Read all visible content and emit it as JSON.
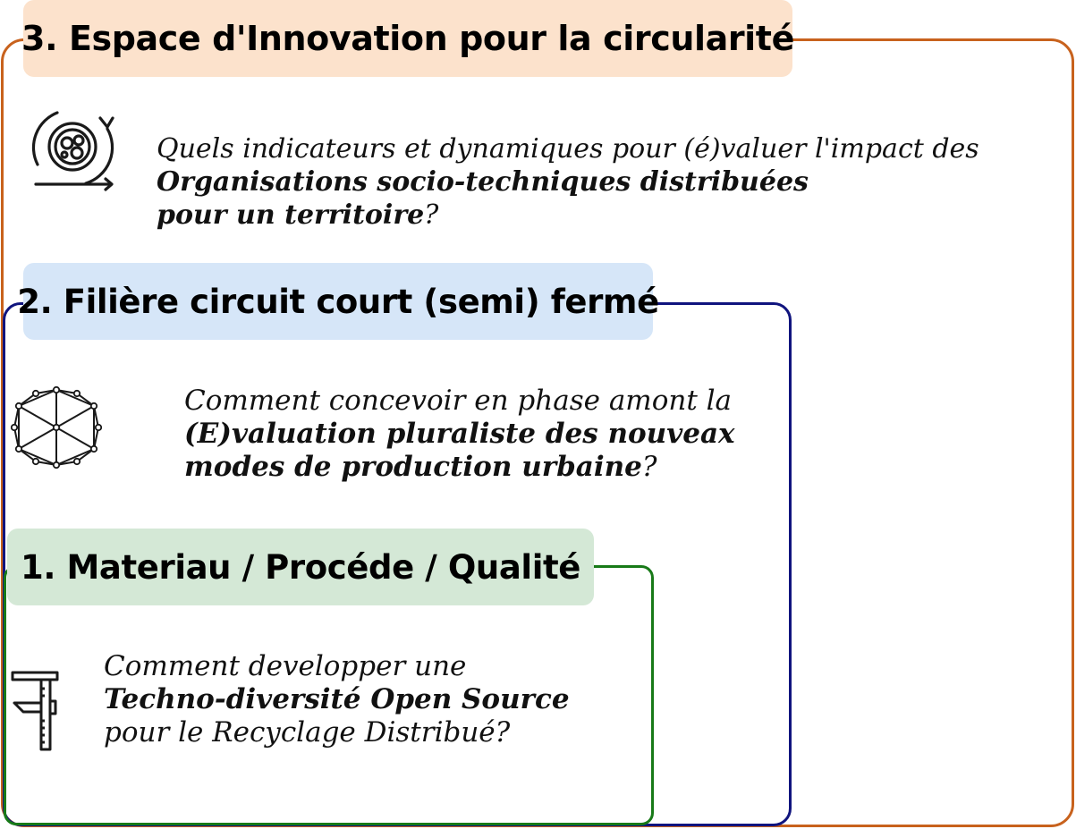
{
  "colors": {
    "level3_border": "#c8621d",
    "level3_fill": "#fce2cc",
    "level2_border": "#10147e",
    "level2_fill": "#d6e6f8",
    "level1_border": "#187a18",
    "level1_fill": "#d4e8d6",
    "icon": "#1a1a1a"
  },
  "level3": {
    "title": "3. Espace d'Innovation pour la circularité",
    "icon": "circular-economy-icon",
    "q_line1": "Quels indicateurs et dynamiques pour (é)valuer l'impact des",
    "q_line2_bold": "Organisations socio-techniques  distribuées",
    "q_line3_bold": "pour un territoire",
    "q_line3_tail": "?"
  },
  "level2": {
    "title": "2. Filière circuit court (semi) fermé",
    "icon": "network-polygon-icon",
    "q_line1": "Comment concevoir en phase amont la",
    "q_line2_bold": "(E)valuation pluraliste des nouveax",
    "q_line3_bold": "modes de production urbaine",
    "q_line3_tail": "?"
  },
  "level1": {
    "title": "1. Materiau / Procéde / Qualité",
    "icon": "caliper-icon",
    "q_line1": "Comment developper une",
    "q_line2_bold": "Techno-diversité Open Source",
    "q_line3": "pour le Recyclage Distribué?"
  }
}
